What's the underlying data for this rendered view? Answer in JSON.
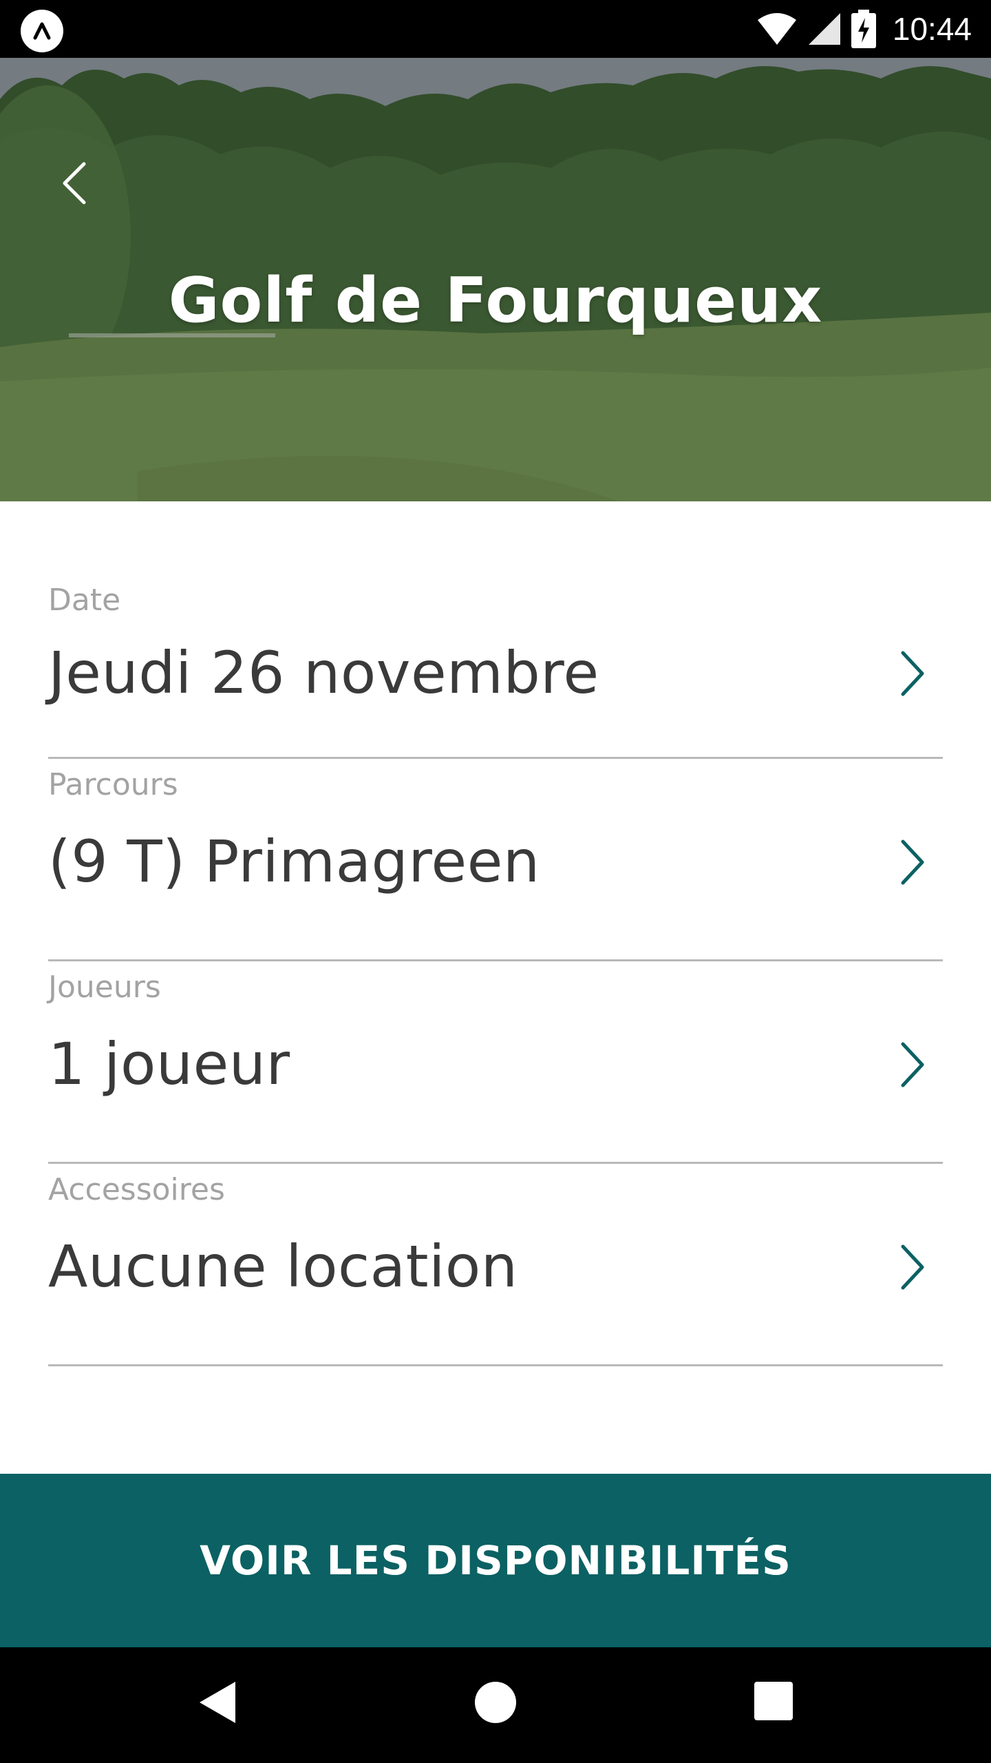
{
  "status_bar": {
    "time": "10:44",
    "icons": [
      "app-logo-icon",
      "wifi-icon",
      "signal-icon",
      "battery-charging-icon"
    ]
  },
  "header": {
    "title": "Golf de Fourqueux",
    "back_icon": "chevron-left-icon"
  },
  "form": {
    "rows": [
      {
        "label": "Date",
        "value": "Jeudi 26 novembre"
      },
      {
        "label": "Parcours",
        "value": "(9 T) Primagreen"
      },
      {
        "label": "Joueurs",
        "value": "1 joueur"
      },
      {
        "label": "Accessoires",
        "value": "Aucune location"
      }
    ],
    "chevron_icon": "chevron-right-icon",
    "chevron_color": "#0b6163"
  },
  "cta": {
    "label": "VOIR LES DISPONIBILITÉS",
    "color": "#0b6163"
  },
  "nav_bar": {
    "icons": [
      "back-triangle-icon",
      "home-circle-icon",
      "recents-square-icon"
    ]
  }
}
